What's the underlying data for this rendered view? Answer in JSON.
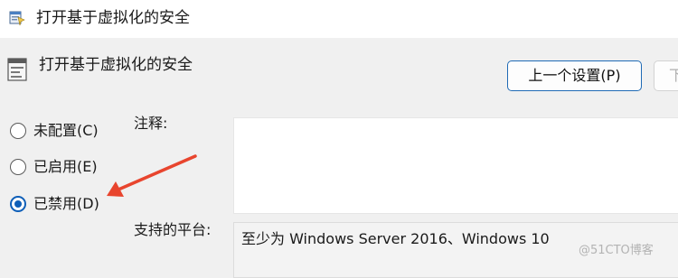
{
  "window": {
    "title": "打开基于虚拟化的安全",
    "icon": "group-policy-icon"
  },
  "header": {
    "setting_name": "打开基于虚拟化的安全",
    "icon": "policy-setting-icon"
  },
  "buttons": {
    "prev_label": "上一个设置(P)",
    "next_label": "下"
  },
  "options": [
    {
      "label": "未配置(C)",
      "selected": false
    },
    {
      "label": "已启用(E)",
      "selected": false
    },
    {
      "label": "已禁用(D)",
      "selected": true
    }
  ],
  "fields": {
    "comment_label": "注释:",
    "comment_value": "",
    "platform_label": "支持的平台:",
    "platform_value": "至少为 Windows Server 2016、Windows 10"
  },
  "annotation": {
    "arrow_color": "#e8452e",
    "points_to": "已禁用(D)"
  },
  "watermark": "@51CTO博客",
  "colors": {
    "accent": "#0f5fb8",
    "arrow": "#e8452e"
  }
}
